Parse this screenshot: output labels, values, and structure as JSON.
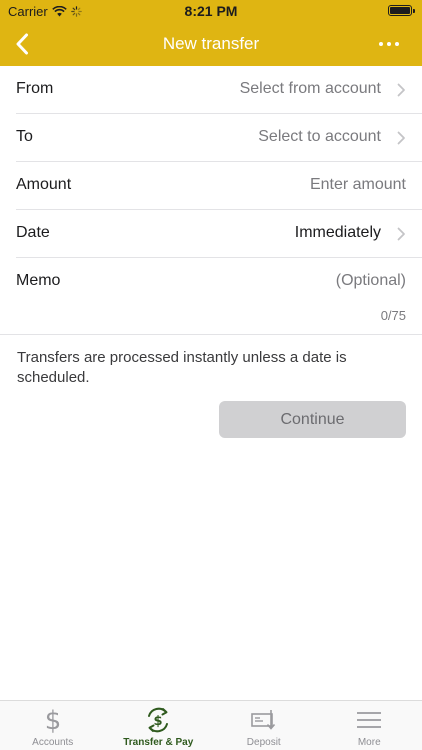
{
  "status_bar": {
    "carrier": "Carrier",
    "time": "8:21 PM"
  },
  "nav": {
    "title": "New transfer",
    "back_icon": "chevron-left-icon",
    "more_icon": "ellipsis-icon"
  },
  "form": {
    "from": {
      "label": "From",
      "value": "Select from account"
    },
    "to": {
      "label": "To",
      "value": "Select to account"
    },
    "amount": {
      "label": "Amount",
      "placeholder": "Enter amount"
    },
    "date": {
      "label": "Date",
      "value": "Immediately"
    },
    "memo": {
      "label": "Memo",
      "placeholder": "(Optional)",
      "count": "0/75"
    }
  },
  "note": "Transfers are processed instantly unless a date is scheduled.",
  "continue_label": "Continue",
  "tabs": [
    {
      "label": "Accounts",
      "icon": "dollar-icon",
      "active": false
    },
    {
      "label": "Transfer & Pay",
      "icon": "transfer-dollar-icon",
      "active": true
    },
    {
      "label": "Deposit",
      "icon": "check-deposit-icon",
      "active": false
    },
    {
      "label": "More",
      "icon": "menu-icon",
      "active": false
    }
  ],
  "colors": {
    "brand": "#dfb512",
    "active_tab": "#2f5a1e",
    "button_disabled": "#d0d0d2"
  }
}
